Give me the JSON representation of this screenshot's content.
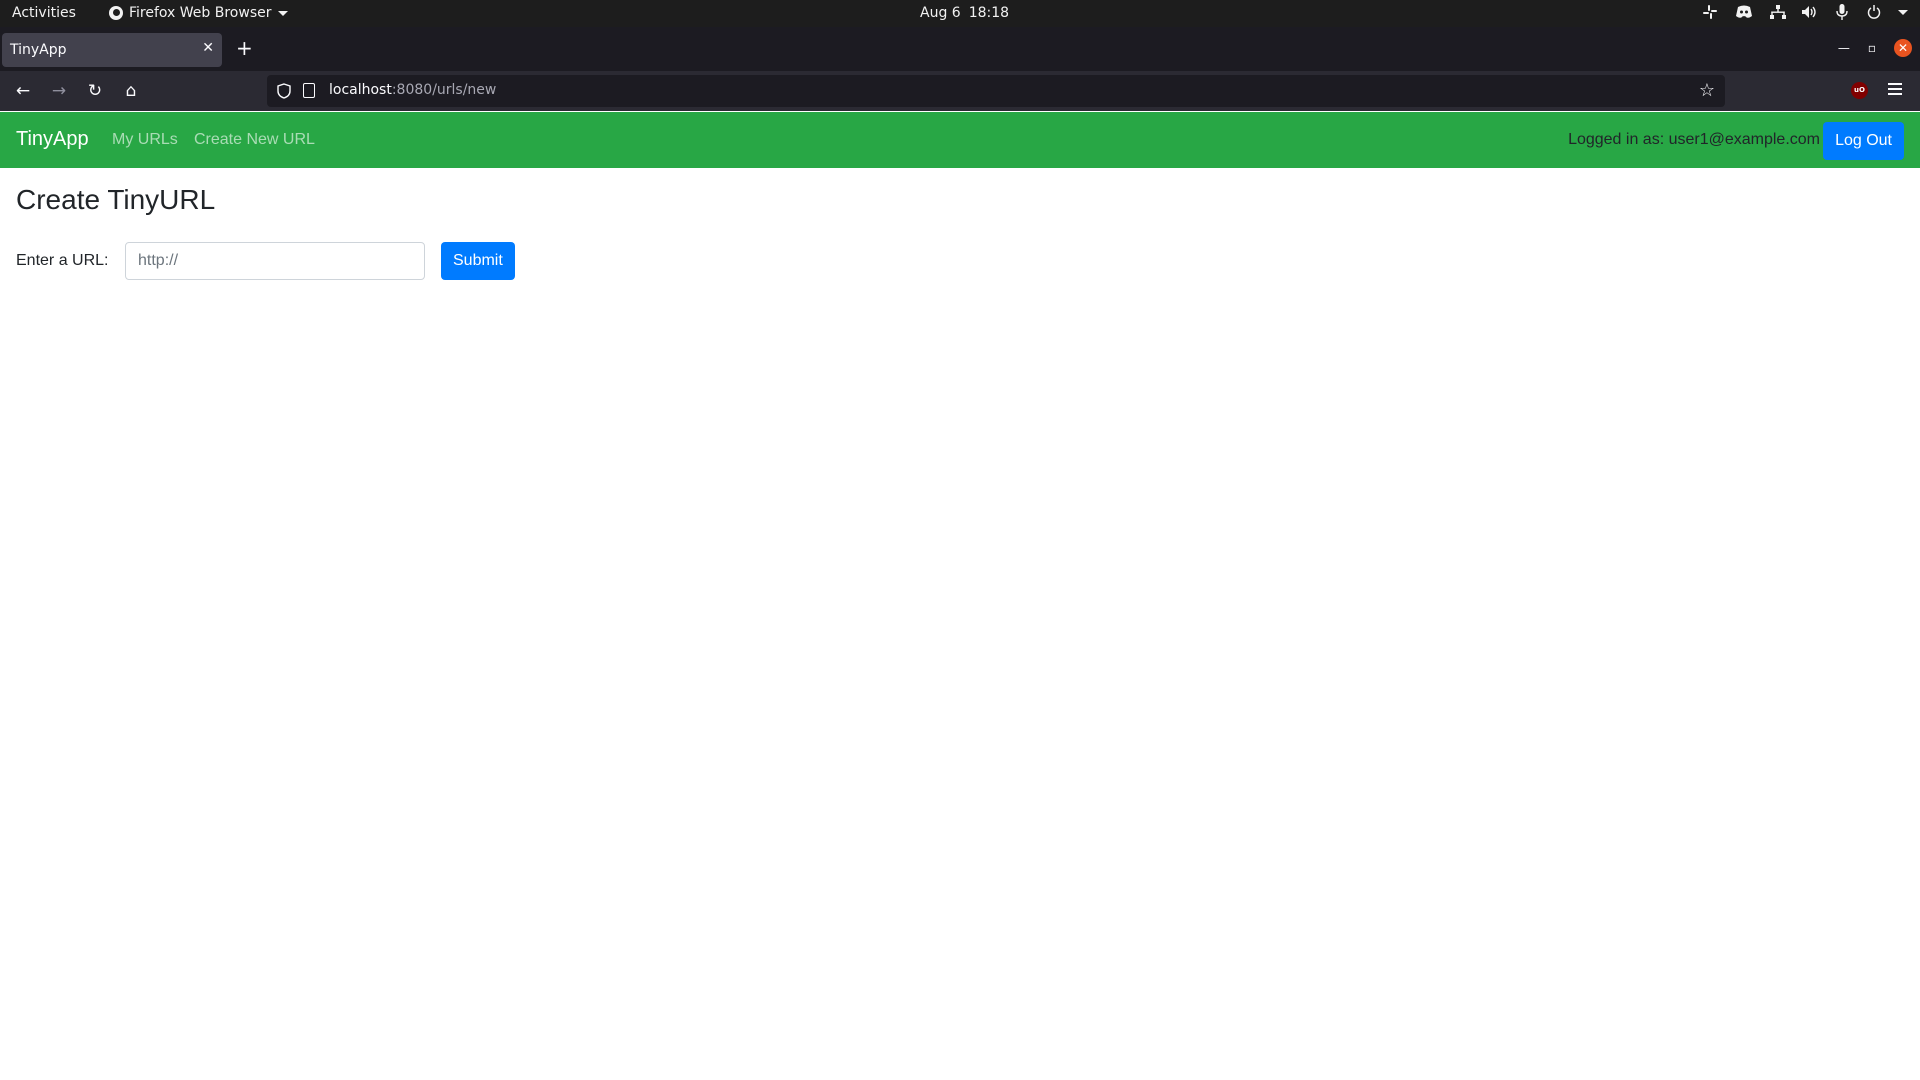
{
  "system_bar": {
    "activities": "Activities",
    "app_name": "Firefox Web Browser",
    "date": "Aug 6",
    "time": "18:18",
    "tray_icons": [
      "slack-icon",
      "discord-icon",
      "network-icon",
      "volume-icon",
      "microphone-icon",
      "power-icon"
    ]
  },
  "browser": {
    "tab_title": "TinyApp",
    "url_host": "localhost",
    "url_rest": ":8080/urls/new"
  },
  "site": {
    "brand": "TinyApp",
    "nav_links": [
      "My URLs",
      "Create New URL"
    ],
    "logged_in_text": "Logged in as: user1@example.com",
    "logout_label": "Log Out",
    "colors": {
      "navbar": "#28a745",
      "primary_button": "#007bff"
    }
  },
  "page": {
    "title": "Create TinyURL",
    "url_label": "Enter a URL:",
    "url_placeholder": "http://",
    "submit_label": "Submit"
  }
}
